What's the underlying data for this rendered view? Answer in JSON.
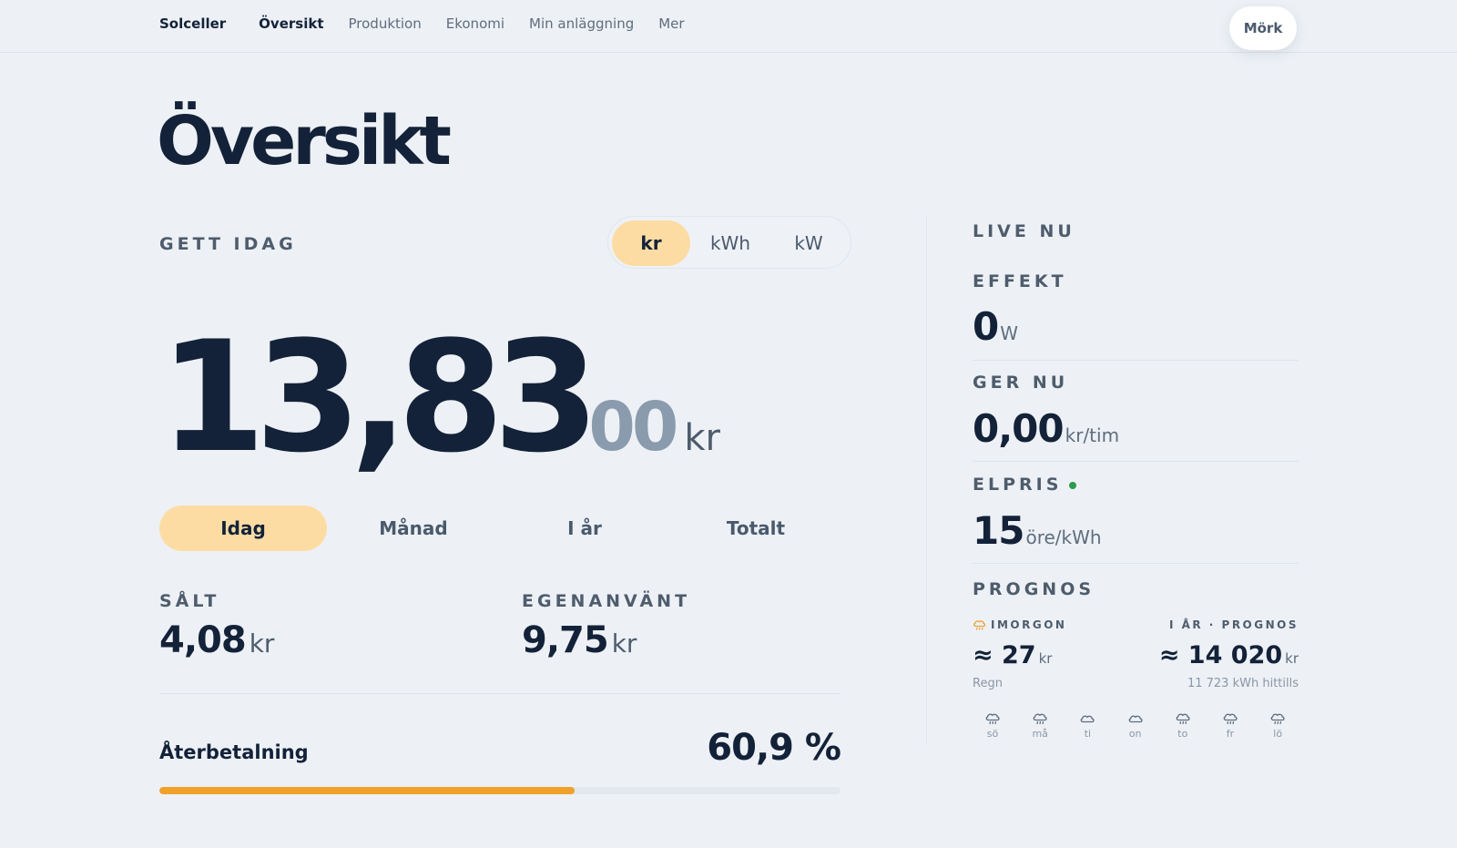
{
  "nav": {
    "brand": "Solceller",
    "items": [
      "Översikt",
      "Produktion",
      "Ekonomi",
      "Min anläggning",
      "Mer"
    ],
    "active_index": 0,
    "theme_button": "Mörk"
  },
  "page": {
    "title": "Översikt"
  },
  "earned": {
    "label": "GETT IDAG",
    "units": [
      "kr",
      "kWh",
      "kW"
    ],
    "active_unit_index": 0,
    "value_int": "13,83",
    "value_dec": "00",
    "value_unit": "kr",
    "periods": [
      "Idag",
      "Månad",
      "I år",
      "Totalt"
    ],
    "active_period_index": 0
  },
  "stats": {
    "sold": {
      "label": "SÅLT",
      "value": "4,08",
      "unit": "kr"
    },
    "self_used": {
      "label": "EGENANVÄNT",
      "value": "9,75",
      "unit": "kr"
    }
  },
  "payback": {
    "label": "Återbetalning",
    "value": "60,9 %",
    "fraction": 0.609
  },
  "live": {
    "label": "LIVE NU",
    "effect": {
      "label": "EFFEKT",
      "value": "0",
      "unit": "W"
    },
    "giving": {
      "label": "GER NU",
      "value": "0,00",
      "unit": "kr/tim"
    },
    "price": {
      "label": "ELPRIS",
      "value": "15",
      "unit": "öre/kWh",
      "status_color": "#2f9a4e"
    }
  },
  "forecast": {
    "label": "PROGNOS",
    "tomorrow": {
      "label": "IMORGON",
      "value": "≈ 27",
      "unit": "kr",
      "sub": "Regn",
      "icon": "rain-cloud-icon"
    },
    "year": {
      "label": "I ÅR · PROGNOS",
      "value": "≈ 14 020",
      "unit": "kr",
      "sub": "11 723 kWh hittills"
    },
    "days": [
      {
        "day": "sö",
        "icon": "rain"
      },
      {
        "day": "må",
        "icon": "rain"
      },
      {
        "day": "ti",
        "icon": "cloud"
      },
      {
        "day": "on",
        "icon": "cloud"
      },
      {
        "day": "to",
        "icon": "rain"
      },
      {
        "day": "fr",
        "icon": "rain"
      },
      {
        "day": "lö",
        "icon": "rain"
      }
    ]
  },
  "colors": {
    "accent": "#f1a12a",
    "accent_soft": "#fddca4",
    "text": "#132238",
    "background": "#edf1f6"
  }
}
